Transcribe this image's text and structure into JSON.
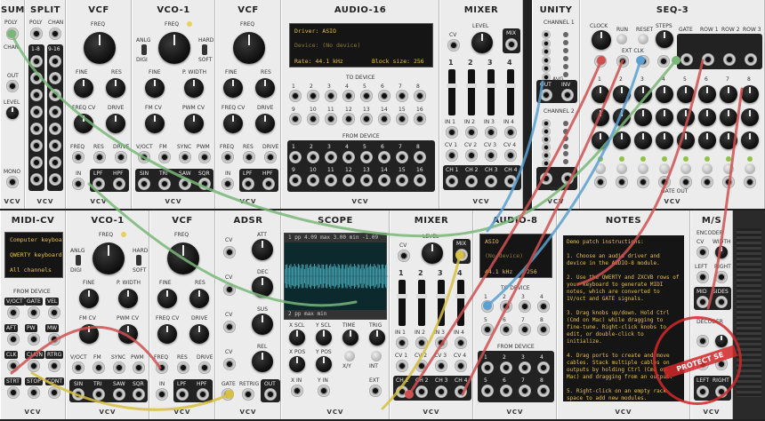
{
  "top_row": {
    "sum": {
      "title": "SUM",
      "poly": "POLY",
      "chan": "CHAN",
      "out": "OUT",
      "level": "LEVEL",
      "mono": "MONO"
    },
    "split": {
      "title": "SPLIT",
      "poly": "POLY",
      "chan": "CHAN",
      "ch1_8": "1-8",
      "ch9_16": "9-16"
    },
    "vcf1": {
      "title": "VCF",
      "freq": "FREQ",
      "fine": "FINE",
      "res": "RES",
      "freq_cv": "FREQ CV",
      "drive": "DRIVE",
      "jack_freq": "FREQ",
      "jack_res": "RES",
      "jack_drive": "DRIVE",
      "in": "IN",
      "lpf": "LPF",
      "hpf": "HPF"
    },
    "vco1": {
      "title": "VCO-1",
      "freq": "FREQ",
      "anlg": "ANLG",
      "digi": "DIGI",
      "hard": "HARD",
      "soft": "SOFT",
      "fine": "FINE",
      "pwidth": "P. WIDTH",
      "fm_cv": "FM CV",
      "pwm_cv": "PWM CV",
      "voct": "V/OCT",
      "fm": "FM",
      "sync": "SYNC",
      "pwm": "PWM",
      "sin": "SIN",
      "tri": "TRI",
      "saw": "SAW",
      "sqr": "SQR"
    },
    "vcf2": {
      "title": "VCF",
      "freq": "FREQ",
      "fine": "FINE",
      "res": "RES",
      "freq_cv": "FREQ CV",
      "drive": "DRIVE",
      "jack_freq": "FREQ",
      "jack_res": "RES",
      "jack_drive": "DRIVE",
      "in": "IN",
      "lpf": "LPF",
      "hpf": "HPF"
    },
    "audio16": {
      "title": "AUDIO-16",
      "driver": "Driver: ASIO",
      "device": "Device: (No device)",
      "rate": "Rate: 44.1 kHz",
      "block": "Block size: 256",
      "to_device": "TO DEVICE",
      "from_device": "FROM DEVICE",
      "to_labels": [
        "1",
        "2",
        "3",
        "4",
        "5",
        "6",
        "7",
        "8",
        "9",
        "10",
        "11",
        "12",
        "13",
        "14",
        "15",
        "16"
      ],
      "from_labels": [
        "1",
        "2",
        "3",
        "4",
        "5",
        "6",
        "7",
        "8",
        "9",
        "10",
        "11",
        "12",
        "13",
        "14",
        "15",
        "16"
      ]
    },
    "mixer": {
      "title": "MIXER",
      "level": "LEVEL",
      "cv": "CV",
      "mix": "MIX",
      "channels": [
        "1",
        "2",
        "3",
        "4"
      ],
      "in": [
        "IN 1",
        "IN 2",
        "IN 3",
        "IN 4"
      ],
      "cv_in": [
        "CV 1",
        "CV 2",
        "CV 3",
        "CV 4"
      ],
      "ch_out": [
        "CH 1",
        "CH 2",
        "CH 3",
        "CH 4"
      ]
    },
    "unity": {
      "title": "UNITY",
      "ch1": "CHANNEL 1",
      "ch2": "CHANNEL 2",
      "out": "OUT",
      "inv": "INV",
      "avg": "AVG",
      "sum": "SUM"
    },
    "seq3": {
      "title": "SEQ-3",
      "clock": "CLOCK",
      "run": "RUN",
      "reset": "RESET",
      "steps": "STEPS",
      "ext_clk": "EXT CLK",
      "gate": "GATE",
      "row1": "ROW 1",
      "row2": "ROW 2",
      "row3": "ROW 3",
      "steps_labels": [
        "1",
        "2",
        "3",
        "4",
        "5",
        "6",
        "7",
        "8"
      ],
      "gate_out": "GATE OUT"
    }
  },
  "bottom_row": {
    "midicv": {
      "title": "MIDI-CV",
      "line1": "Computer keyboa",
      "line2": "QWERTY keyboard",
      "line3": "All channels",
      "from_device": "FROM DEVICE",
      "jacks": [
        "V/OCT",
        "GATE",
        "VEL",
        "AFT",
        "PW",
        "MW",
        "CLK",
        "CLK/N",
        "RTRG",
        "STRT",
        "STOP",
        "CONT"
      ]
    },
    "vco1": {
      "title": "VCO-1",
      "freq": "FREQ",
      "anlg": "ANLG",
      "digi": "DIGI",
      "hard": "HARD",
      "soft": "SOFT",
      "fine": "FINE",
      "pwidth": "P. WIDTH",
      "fm_cv": "FM CV",
      "pwm_cv": "PWM CV",
      "voct": "V/OCT",
      "fm": "FM",
      "sync": "SYNC",
      "pwm": "PWM",
      "sin": "SIN",
      "tri": "TRI",
      "saw": "SAW",
      "sqr": "SQR"
    },
    "vcf": {
      "title": "VCF",
      "freq": "FREQ",
      "fine": "FINE",
      "res": "RES",
      "freq_cv": "FREQ CV",
      "drive": "DRIVE",
      "jack_freq": "FREQ",
      "jack_res": "RES",
      "jack_drive": "DRIVE",
      "in": "IN",
      "lpf": "LPF",
      "hpf": "HPF"
    },
    "adsr": {
      "title": "ADSR",
      "att": "ATT",
      "dec": "DEC",
      "sus": "SUS",
      "rel": "REL",
      "cv": "CV",
      "gate": "GATE",
      "retrig": "RETRIG",
      "out": "OUT"
    },
    "scope": {
      "title": "SCOPE",
      "top_bar": "1  pp   4.09   max   3.00  min  -1.09",
      "bottom_bar": "2  pp        max        min",
      "xscl": "X SCL",
      "yscl": "Y SCL",
      "time": "TIME",
      "trig": "TRIG",
      "xpos": "X POS",
      "ypos": "Y POS",
      "xy": "X/Y",
      "int": "INT",
      "xin": "X IN",
      "yin": "Y IN",
      "ext": "EXT"
    },
    "mixer": {
      "title": "MIXER",
      "level": "LEVEL",
      "cv": "CV",
      "mix": "MIX",
      "channels": [
        "1",
        "2",
        "3",
        "4"
      ],
      "in": [
        "IN 1",
        "IN 2",
        "IN 3",
        "IN 4"
      ],
      "cv_in": [
        "CV 1",
        "CV 2",
        "CV 3",
        "CV 4"
      ],
      "ch_out": [
        "CH 1",
        "CH 2",
        "CH 3",
        "CH 4"
      ]
    },
    "audio8": {
      "title": "AUDIO-8",
      "driver": "ASIO",
      "device": "(No device)",
      "rate": "44.1 kHz",
      "block": "256",
      "to_device": "TO DEVICE",
      "from_device": "FROM DEVICE",
      "to_labels": [
        "1",
        "2",
        "3",
        "4",
        "5",
        "6",
        "7",
        "8"
      ],
      "from_labels": [
        "1",
        "2",
        "3",
        "4",
        "5",
        "6",
        "7",
        "8"
      ]
    },
    "notes": {
      "title": "NOTES",
      "text": "Demo patch instructions:\n\n1. Choose an audio driver and device in the AUDIO-8 module.\n\n2. Use the QWERTY and ZXCVB rows of your keyboard to generate MIDI notes, which are converted to 1V/oct and GATE signals.\n\n3. Drag knobs up/down. Hold Ctrl (Cmd on Mac) while dragging to fine-tune. Right-click knobs to edit, or double-click to initialize.\n\n4. Drag ports to create and move cables. Stack multiple cables on outputs by holding Ctrl (Cmd on Mac) and dragging from an output.\n\n5. Right-click on an empty rack space to add new modules."
    },
    "ms": {
      "title": "M/S",
      "encoder": "ENCODER",
      "cv": "CV",
      "width": "WIDTH",
      "left": "LEFT",
      "right": "RIGHT",
      "mid": "MID",
      "sides": "SIDES",
      "decoder": "DECODER"
    }
  },
  "brand": "VCV",
  "stamp_text": "PROTECT SE",
  "colors": {
    "panel": "#ececec",
    "screen_text": "#e8c040",
    "cable_green": "#7ab87a",
    "cable_red": "#d05050",
    "cable_blue": "#5aa0d0",
    "cable_yellow": "#d8c040",
    "stamp": "#d22828"
  }
}
